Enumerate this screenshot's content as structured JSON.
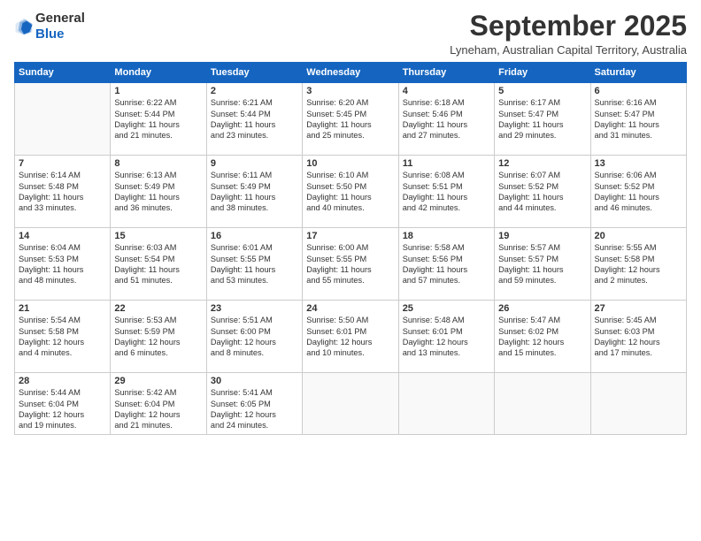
{
  "logo": {
    "general": "General",
    "blue": "Blue"
  },
  "header": {
    "month": "September 2025",
    "location": "Lyneham, Australian Capital Territory, Australia"
  },
  "weekdays": [
    "Sunday",
    "Monday",
    "Tuesday",
    "Wednesday",
    "Thursday",
    "Friday",
    "Saturday"
  ],
  "weeks": [
    [
      {
        "day": "",
        "info": ""
      },
      {
        "day": "1",
        "info": "Sunrise: 6:22 AM\nSunset: 5:44 PM\nDaylight: 11 hours\nand 21 minutes."
      },
      {
        "day": "2",
        "info": "Sunrise: 6:21 AM\nSunset: 5:44 PM\nDaylight: 11 hours\nand 23 minutes."
      },
      {
        "day": "3",
        "info": "Sunrise: 6:20 AM\nSunset: 5:45 PM\nDaylight: 11 hours\nand 25 minutes."
      },
      {
        "day": "4",
        "info": "Sunrise: 6:18 AM\nSunset: 5:46 PM\nDaylight: 11 hours\nand 27 minutes."
      },
      {
        "day": "5",
        "info": "Sunrise: 6:17 AM\nSunset: 5:47 PM\nDaylight: 11 hours\nand 29 minutes."
      },
      {
        "day": "6",
        "info": "Sunrise: 6:16 AM\nSunset: 5:47 PM\nDaylight: 11 hours\nand 31 minutes."
      }
    ],
    [
      {
        "day": "7",
        "info": "Sunrise: 6:14 AM\nSunset: 5:48 PM\nDaylight: 11 hours\nand 33 minutes."
      },
      {
        "day": "8",
        "info": "Sunrise: 6:13 AM\nSunset: 5:49 PM\nDaylight: 11 hours\nand 36 minutes."
      },
      {
        "day": "9",
        "info": "Sunrise: 6:11 AM\nSunset: 5:49 PM\nDaylight: 11 hours\nand 38 minutes."
      },
      {
        "day": "10",
        "info": "Sunrise: 6:10 AM\nSunset: 5:50 PM\nDaylight: 11 hours\nand 40 minutes."
      },
      {
        "day": "11",
        "info": "Sunrise: 6:08 AM\nSunset: 5:51 PM\nDaylight: 11 hours\nand 42 minutes."
      },
      {
        "day": "12",
        "info": "Sunrise: 6:07 AM\nSunset: 5:52 PM\nDaylight: 11 hours\nand 44 minutes."
      },
      {
        "day": "13",
        "info": "Sunrise: 6:06 AM\nSunset: 5:52 PM\nDaylight: 11 hours\nand 46 minutes."
      }
    ],
    [
      {
        "day": "14",
        "info": "Sunrise: 6:04 AM\nSunset: 5:53 PM\nDaylight: 11 hours\nand 48 minutes."
      },
      {
        "day": "15",
        "info": "Sunrise: 6:03 AM\nSunset: 5:54 PM\nDaylight: 11 hours\nand 51 minutes."
      },
      {
        "day": "16",
        "info": "Sunrise: 6:01 AM\nSunset: 5:55 PM\nDaylight: 11 hours\nand 53 minutes."
      },
      {
        "day": "17",
        "info": "Sunrise: 6:00 AM\nSunset: 5:55 PM\nDaylight: 11 hours\nand 55 minutes."
      },
      {
        "day": "18",
        "info": "Sunrise: 5:58 AM\nSunset: 5:56 PM\nDaylight: 11 hours\nand 57 minutes."
      },
      {
        "day": "19",
        "info": "Sunrise: 5:57 AM\nSunset: 5:57 PM\nDaylight: 11 hours\nand 59 minutes."
      },
      {
        "day": "20",
        "info": "Sunrise: 5:55 AM\nSunset: 5:58 PM\nDaylight: 12 hours\nand 2 minutes."
      }
    ],
    [
      {
        "day": "21",
        "info": "Sunrise: 5:54 AM\nSunset: 5:58 PM\nDaylight: 12 hours\nand 4 minutes."
      },
      {
        "day": "22",
        "info": "Sunrise: 5:53 AM\nSunset: 5:59 PM\nDaylight: 12 hours\nand 6 minutes."
      },
      {
        "day": "23",
        "info": "Sunrise: 5:51 AM\nSunset: 6:00 PM\nDaylight: 12 hours\nand 8 minutes."
      },
      {
        "day": "24",
        "info": "Sunrise: 5:50 AM\nSunset: 6:01 PM\nDaylight: 12 hours\nand 10 minutes."
      },
      {
        "day": "25",
        "info": "Sunrise: 5:48 AM\nSunset: 6:01 PM\nDaylight: 12 hours\nand 13 minutes."
      },
      {
        "day": "26",
        "info": "Sunrise: 5:47 AM\nSunset: 6:02 PM\nDaylight: 12 hours\nand 15 minutes."
      },
      {
        "day": "27",
        "info": "Sunrise: 5:45 AM\nSunset: 6:03 PM\nDaylight: 12 hours\nand 17 minutes."
      }
    ],
    [
      {
        "day": "28",
        "info": "Sunrise: 5:44 AM\nSunset: 6:04 PM\nDaylight: 12 hours\nand 19 minutes."
      },
      {
        "day": "29",
        "info": "Sunrise: 5:42 AM\nSunset: 6:04 PM\nDaylight: 12 hours\nand 21 minutes."
      },
      {
        "day": "30",
        "info": "Sunrise: 5:41 AM\nSunset: 6:05 PM\nDaylight: 12 hours\nand 24 minutes."
      },
      {
        "day": "",
        "info": ""
      },
      {
        "day": "",
        "info": ""
      },
      {
        "day": "",
        "info": ""
      },
      {
        "day": "",
        "info": ""
      }
    ]
  ]
}
